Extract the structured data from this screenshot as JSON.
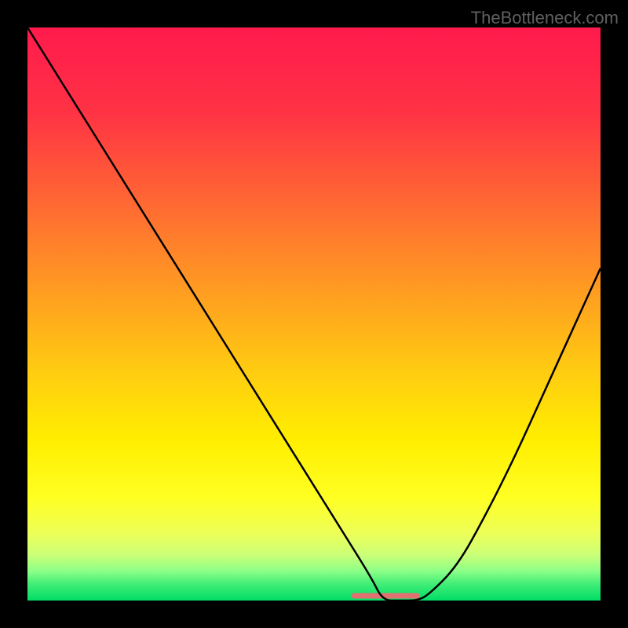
{
  "watermark": "TheBottleneck.com",
  "chart_data": {
    "type": "line",
    "title": "",
    "xlabel": "",
    "ylabel": "",
    "xlim": [
      0,
      100
    ],
    "ylim": [
      0,
      100
    ],
    "x": [
      0,
      5,
      10,
      15,
      20,
      25,
      30,
      35,
      40,
      45,
      50,
      55,
      60,
      62,
      65,
      68,
      70,
      75,
      80,
      85,
      90,
      95,
      100
    ],
    "values": [
      100,
      92,
      84,
      76,
      68,
      60,
      52,
      44,
      36,
      28,
      20,
      12,
      4,
      0,
      0,
      0,
      1,
      6,
      15,
      25,
      36,
      47,
      58
    ],
    "gradient_stops": [
      {
        "pos": 0,
        "color": "#ff1a4d"
      },
      {
        "pos": 15,
        "color": "#ff3344"
      },
      {
        "pos": 30,
        "color": "#ff6633"
      },
      {
        "pos": 45,
        "color": "#ff9922"
      },
      {
        "pos": 60,
        "color": "#ffcc11"
      },
      {
        "pos": 72,
        "color": "#ffee00"
      },
      {
        "pos": 82,
        "color": "#ffff22"
      },
      {
        "pos": 88,
        "color": "#eeff55"
      },
      {
        "pos": 92,
        "color": "#ccff77"
      },
      {
        "pos": 95,
        "color": "#88ff88"
      },
      {
        "pos": 97,
        "color": "#44ee77"
      },
      {
        "pos": 100,
        "color": "#00dd66"
      }
    ],
    "plateau": {
      "x_start": 57,
      "x_end": 68,
      "color": "#e17070",
      "width": 7
    }
  }
}
